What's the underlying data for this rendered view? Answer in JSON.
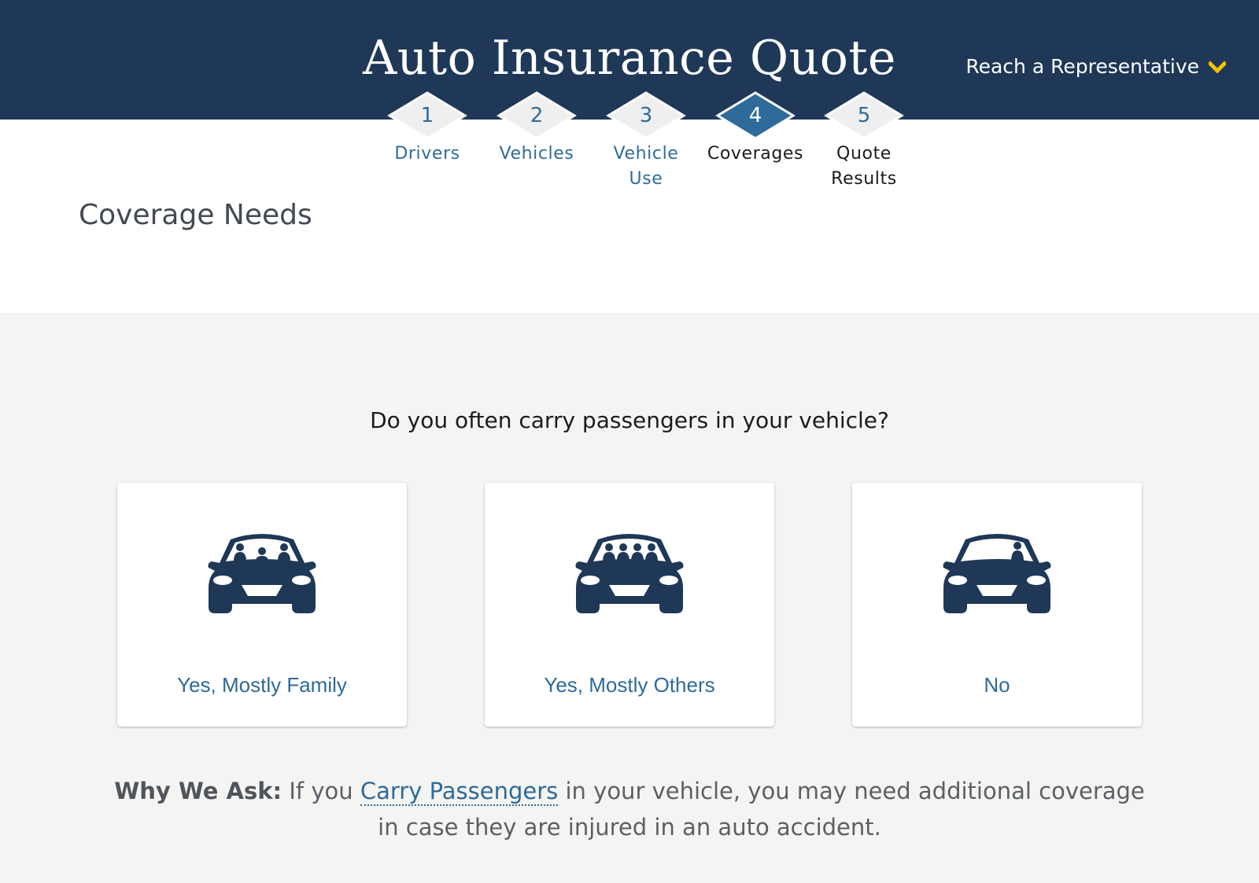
{
  "header": {
    "title": "Auto Insurance Quote",
    "rep_label": "Reach a Representative",
    "rep_icon": "chevron-down-icon",
    "bg_color": "#1f3858",
    "accent_color": "#f2c300"
  },
  "steps": [
    {
      "number": "1",
      "label": "Drivers",
      "state": "completed"
    },
    {
      "number": "2",
      "label": "Vehicles",
      "state": "completed"
    },
    {
      "number": "3",
      "label": "Vehicle\nUse",
      "state": "completed"
    },
    {
      "number": "4",
      "label": "Coverages",
      "state": "active"
    },
    {
      "number": "5",
      "label": "Quote\nResults",
      "state": "upcoming"
    }
  ],
  "section": {
    "title": "Coverage Needs"
  },
  "question": "Do you often carry passengers in your vehicle?",
  "options": [
    {
      "label": "Yes, Mostly Family",
      "icon": "car-family-passengers-icon"
    },
    {
      "label": "Yes, Mostly Others",
      "icon": "car-other-passengers-icon"
    },
    {
      "label": "No",
      "icon": "car-driver-only-icon"
    }
  ],
  "why": {
    "lead": "Why We Ask:",
    "pre": " If you ",
    "link": "Carry Passengers",
    "post": " in your vehicle, you may need additional coverage in case they are injured in an auto accident."
  },
  "colors": {
    "link": "#2d6a98",
    "car": "#1f3858",
    "page_bg": "#f4f4f2"
  }
}
